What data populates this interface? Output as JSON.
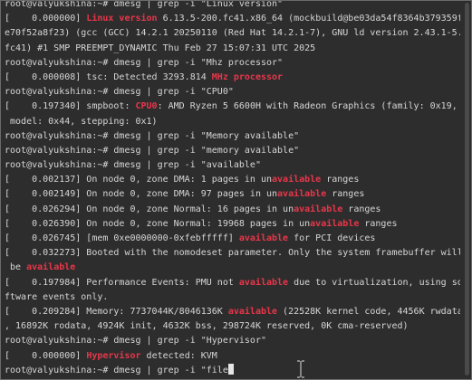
{
  "terminal": {
    "lines": [
      {
        "segments": [
          {
            "text": "root@valyukshina:~# dmesg | grep -i \"Linux version\"",
            "hl": false
          }
        ]
      },
      {
        "segments": [
          {
            "text": "[    0.000000] ",
            "hl": false
          },
          {
            "text": "Linux version",
            "hl": true
          },
          {
            "text": " 6.13.5-200.fc41.x86_64 (mockbuild@be03da54f8364b379359f",
            "hl": false
          }
        ]
      },
      {
        "segments": [
          {
            "text": "e70f52a8f23) (gcc (GCC) 14.2.1 20250110 (Red Hat 14.2.1-7), GNU ld version 2.43.1-5.",
            "hl": false
          }
        ]
      },
      {
        "segments": [
          {
            "text": "fc41) #1 SMP PREEMPT_DYNAMIC Thu Feb 27 15:07:31 UTC 2025",
            "hl": false
          }
        ]
      },
      {
        "segments": [
          {
            "text": "root@valyukshina:~# dmesg | grep -i \"Mhz processor\"",
            "hl": false
          }
        ]
      },
      {
        "segments": [
          {
            "text": "[    0.000008] tsc: Detected 3293.814 ",
            "hl": false
          },
          {
            "text": "MHz processor",
            "hl": true
          }
        ]
      },
      {
        "segments": [
          {
            "text": "root@valyukshina:~# dmesg | grep -i \"CPU0\"",
            "hl": false
          }
        ]
      },
      {
        "segments": [
          {
            "text": "[    0.197340] smpboot: ",
            "hl": false
          },
          {
            "text": "CPU0",
            "hl": true
          },
          {
            "text": ": AMD Ryzen 5 6600H with Radeon Graphics (family: 0x19,",
            "hl": false
          }
        ]
      },
      {
        "segments": [
          {
            "text": " model: 0x44, stepping: 0x1)",
            "hl": false
          }
        ]
      },
      {
        "segments": [
          {
            "text": "root@valyukshina:~# dmesg | grep -i \"Memory available\"",
            "hl": false
          }
        ]
      },
      {
        "segments": [
          {
            "text": "root@valyukshina:~# dmesg | grep -i \"memory available\"",
            "hl": false
          }
        ]
      },
      {
        "segments": [
          {
            "text": "root@valyukshina:~# dmesg | grep -i \"available\"",
            "hl": false
          }
        ]
      },
      {
        "segments": [
          {
            "text": "[    0.002137] On node 0, zone DMA: 1 pages in un",
            "hl": false
          },
          {
            "text": "available",
            "hl": true
          },
          {
            "text": " ranges",
            "hl": false
          }
        ]
      },
      {
        "segments": [
          {
            "text": "[    0.002149] On node 0, zone DMA: 97 pages in un",
            "hl": false
          },
          {
            "text": "available",
            "hl": true
          },
          {
            "text": " ranges",
            "hl": false
          }
        ]
      },
      {
        "segments": [
          {
            "text": "[    0.026294] On node 0, zone Normal: 16 pages in un",
            "hl": false
          },
          {
            "text": "available",
            "hl": true
          },
          {
            "text": " ranges",
            "hl": false
          }
        ]
      },
      {
        "segments": [
          {
            "text": "[    0.026390] On node 0, zone Normal: 19968 pages in un",
            "hl": false
          },
          {
            "text": "available",
            "hl": true
          },
          {
            "text": " ranges",
            "hl": false
          }
        ]
      },
      {
        "segments": [
          {
            "text": "[    0.026745] [mem 0xe0000000-0xfebfffff] ",
            "hl": false
          },
          {
            "text": "available",
            "hl": true
          },
          {
            "text": " for PCI devices",
            "hl": false
          }
        ]
      },
      {
        "segments": [
          {
            "text": "[    0.032273] Booted with the nomodeset parameter. Only the system framebuffer will",
            "hl": false
          }
        ]
      },
      {
        "segments": [
          {
            "text": " be ",
            "hl": false
          },
          {
            "text": "available",
            "hl": true
          }
        ]
      },
      {
        "segments": [
          {
            "text": "[    0.197984] Performance Events: PMU not ",
            "hl": false
          },
          {
            "text": "available",
            "hl": true
          },
          {
            "text": " due to virtualization, using so",
            "hl": false
          }
        ]
      },
      {
        "segments": [
          {
            "text": "ftware events only.",
            "hl": false
          }
        ]
      },
      {
        "segments": [
          {
            "text": "[    0.209284] Memory: 7737044K/8046136K ",
            "hl": false
          },
          {
            "text": "available",
            "hl": true
          },
          {
            "text": " (22528K kernel code, 4456K rwdata",
            "hl": false
          }
        ]
      },
      {
        "segments": [
          {
            "text": ", 16892K rodata, 4924K init, 4632K bss, 298724K reserved, 0K cma-reserved)",
            "hl": false
          }
        ]
      },
      {
        "segments": [
          {
            "text": "root@valyukshina:~# dmesg | grep -i \"Hypervisor\"",
            "hl": false
          }
        ]
      },
      {
        "segments": [
          {
            "text": "[    0.000000] ",
            "hl": false
          },
          {
            "text": "Hypervisor",
            "hl": true
          },
          {
            "text": " detected: KVM",
            "hl": false
          }
        ]
      },
      {
        "segments": [
          {
            "text": "root@valyukshina:~# dmesg | grep -i \"file",
            "hl": false
          }
        ],
        "cursor": true
      }
    ]
  },
  "colors": {
    "background": "#2d2d2d",
    "text": "#d6d6d6",
    "match_highlight": "#e8364a"
  },
  "icons": {
    "mouse_pointer": "text-ibeam-icon"
  }
}
